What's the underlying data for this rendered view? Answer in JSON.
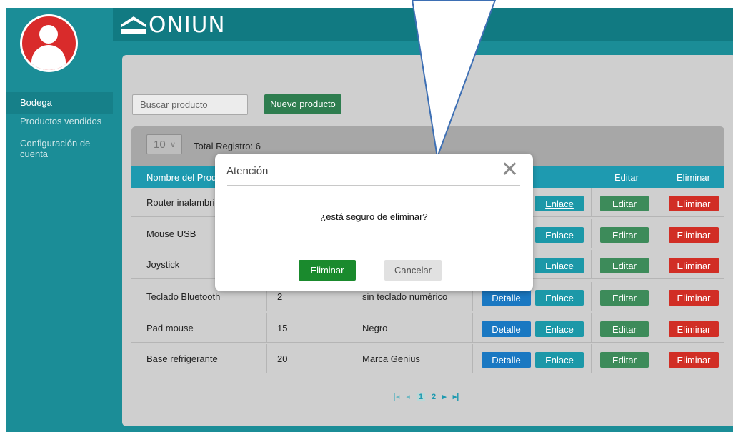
{
  "brand": "ONIUN",
  "sidebar": {
    "items": [
      {
        "label": "Bodega"
      },
      {
        "label": "Productos vendidos"
      },
      {
        "label": "Configuración de cuenta"
      }
    ]
  },
  "toolbar": {
    "search_placeholder": "Buscar producto",
    "new_label": "Nuevo producto"
  },
  "table": {
    "page_size": "10",
    "total_label": "Total Registro: 6",
    "headers": {
      "name": "Nombre del Producto",
      "edit": "Editar",
      "delete": "Eliminar"
    },
    "rows": [
      {
        "name": "Router inalambrico",
        "qty": "",
        "desc": "",
        "detail": "",
        "link": "Enlace",
        "edit": "Editar",
        "delete": "Eliminar"
      },
      {
        "name": "Mouse USB",
        "qty": "",
        "desc": "",
        "detail": "",
        "link": "Enlace",
        "edit": "Editar",
        "delete": "Eliminar"
      },
      {
        "name": "Joystick",
        "qty": "",
        "desc": "",
        "detail": "",
        "link": "Enlace",
        "edit": "Editar",
        "delete": "Eliminar"
      },
      {
        "name": "Teclado Bluetooth",
        "qty": "2",
        "desc": "sin teclado numérico",
        "detail": "Detalle",
        "link": "Enlace",
        "edit": "Editar",
        "delete": "Eliminar"
      },
      {
        "name": "Pad mouse",
        "qty": "15",
        "desc": "Negro",
        "detail": "Detalle",
        "link": "Enlace",
        "edit": "Editar",
        "delete": "Eliminar"
      },
      {
        "name": "Base refrigerante",
        "qty": "20",
        "desc": "Marca Genius",
        "detail": "Detalle",
        "link": "Enlace",
        "edit": "Editar",
        "delete": "Eliminar"
      }
    ]
  },
  "pagination": {
    "first": "|◂",
    "prev": "◂",
    "page1": "1",
    "page2": "2",
    "next": "▸",
    "last": "▸|"
  },
  "modal": {
    "title": "Atención",
    "close": "✕",
    "message": "¿está seguro de eliminar?",
    "confirm": "Eliminar",
    "cancel": "Cancelar"
  },
  "colors": {
    "sidebar": "#1b8d97",
    "header": "#117a82",
    "table_header": "#1e9ab0",
    "danger": "#d12e25",
    "success": "#2e7d4f"
  }
}
